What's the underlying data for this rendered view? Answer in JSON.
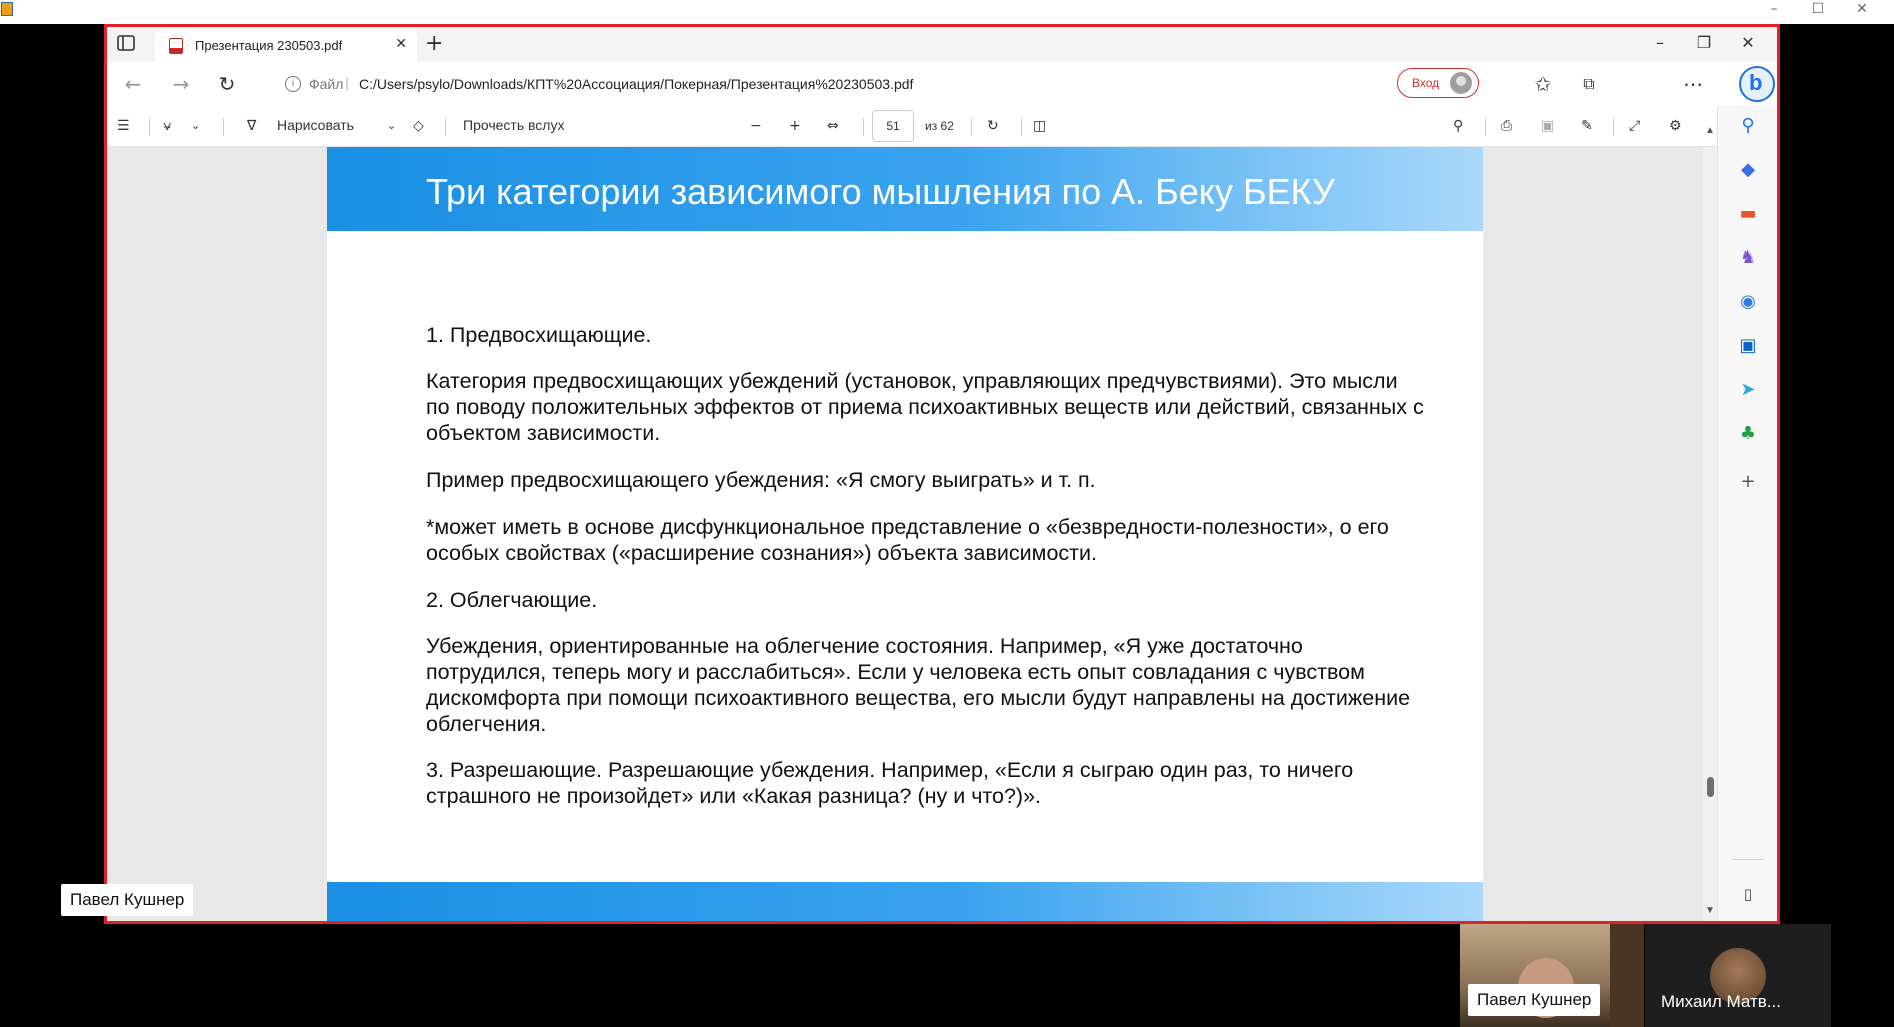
{
  "host_window": {
    "controls": [
      "–",
      "☐",
      "✕"
    ]
  },
  "browser": {
    "tab_title": "Презентация 230503.pdf",
    "new_tab": "+",
    "window_controls": [
      "–",
      "❐",
      "✕"
    ],
    "address": {
      "scheme_label": "Файл",
      "url": "C:/Users/psylo/Downloads/КПТ%20Ассоциация/Покерная/Презентация%20230503.pdf"
    },
    "sign_in_label": "Вход",
    "bing_label": "b"
  },
  "pdf_toolbar": {
    "draw_label": "Нарисовать",
    "read_aloud_label": "Прочесть вслух",
    "current_page": "51",
    "page_total_label": "из 62"
  },
  "slide": {
    "title": "Три категории зависимого мышления по А. Беку БЕКУ",
    "paragraphs": [
      "1. Предвосхищающие.",
      "Категория предвосхищающих убеждений (установок, управляющих предчувствиями). Это мысли по поводу положительных эффектов от приема психоактивных веществ или действий, связанных с объектом зависимости.",
      "Пример предвосхищающего убеждения: «Я смогу выиграть» и т. п.",
      "*может иметь в основе дисфункциональное представление о «безвредности-полезности», о его особых свойствах («расширение сознания») объекта зависимости.",
      "2. Облегчающие.",
      "Убеждения, ориентированные на облегчение состояния. Например, «Я уже достаточно потрудился, теперь могу и расслабиться». Если у человека есть опыт совладания с чувством дискомфорта при помощи психоактивного вещества, его мысли будут направлены на достижение облегчения.",
      "3. Разрешающие. Разрешающие убеждения. Например, «Если я сыграю один раз, то ничего страшного не произойдет» или «Какая разница? (ну и что?)»."
    ]
  },
  "participants": {
    "presenter_tag": "Павел Кушнер",
    "tile1_name": "Павел Кушнер",
    "tile2_name": "Михаил Матв..."
  },
  "colors": {
    "share_outline": "#e2222b",
    "slide_header_start": "#1a8fe3",
    "slide_header_end": "#a9d9fb"
  }
}
